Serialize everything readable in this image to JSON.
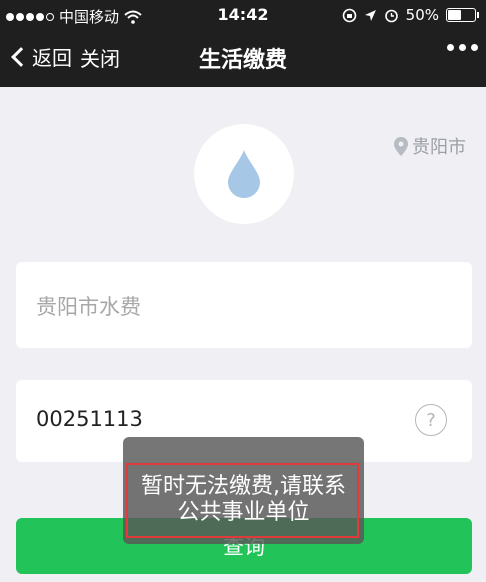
{
  "status_bar": {
    "carrier": "中国移动",
    "time": "14:42",
    "battery": "50%",
    "battery_level": 0.5
  },
  "nav": {
    "back_label": "返回",
    "close_label": "关闭",
    "title": "生活缴费"
  },
  "location": "贵阳市",
  "service": {
    "label": "贵阳市水费"
  },
  "account": {
    "value": "00251113",
    "help_symbol": "?"
  },
  "query_button": "查询",
  "toast": {
    "line1": "暂时无法缴费,请联系",
    "line2": "公共事业单位"
  },
  "colors": {
    "accent": "#22c45a",
    "highlight": "#e03a3a",
    "drop": "#a6c8e6"
  }
}
